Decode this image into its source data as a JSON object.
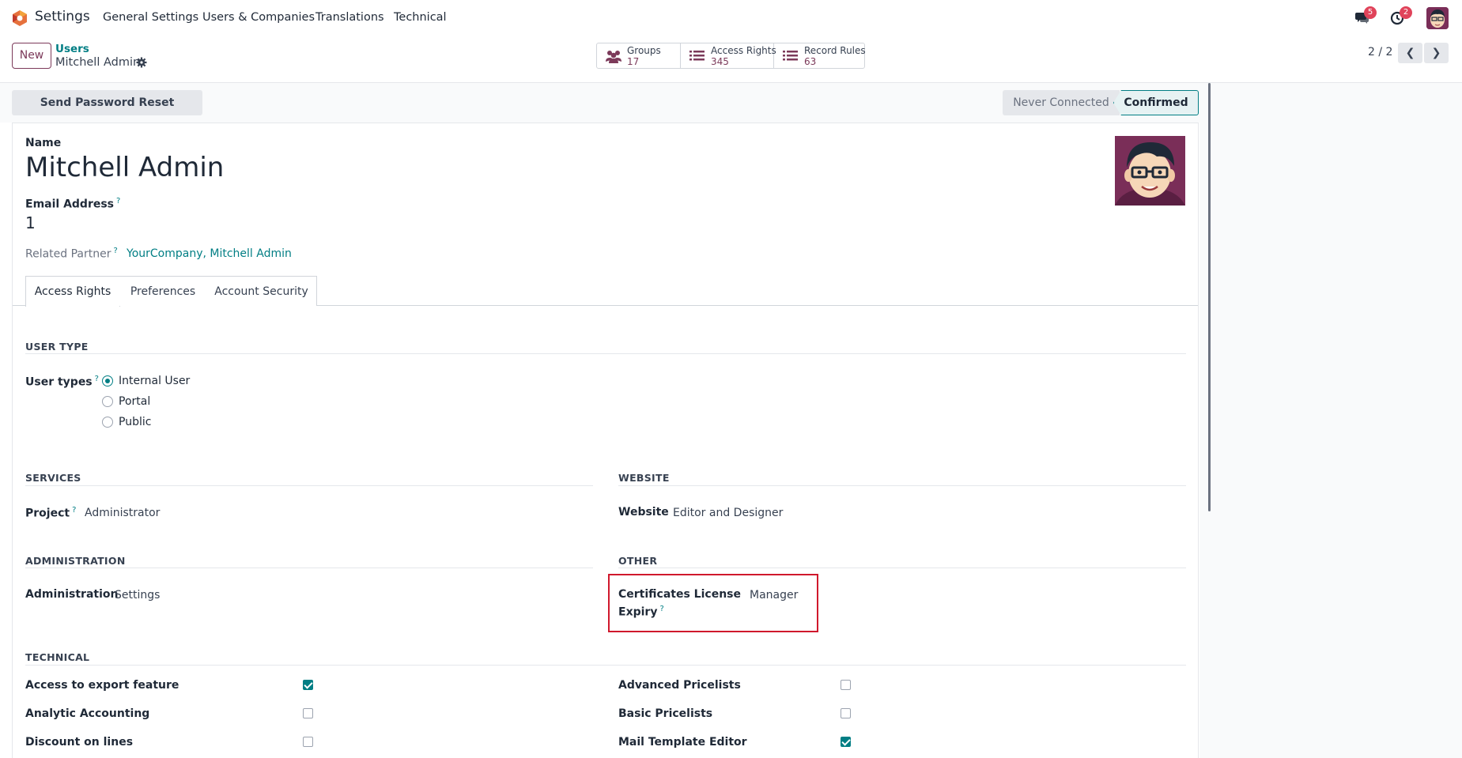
{
  "navbar": {
    "app_name": "Settings",
    "menu": [
      "General Settings",
      "Users & Companies",
      "Translations",
      "Technical"
    ],
    "messages_count": "5",
    "activities_count": "2"
  },
  "control_panel": {
    "new_label": "New",
    "breadcrumb_parent": "Users",
    "breadcrumb_current": "Mitchell Admin",
    "smart_buttons": [
      {
        "label": "Groups",
        "value": "17"
      },
      {
        "label": "Access Rights",
        "value": "345"
      },
      {
        "label": "Record Rules",
        "value": "63"
      }
    ],
    "pager": "2 / 2"
  },
  "statusbar": {
    "reset_button": "Send Password Reset Instructions",
    "stages": [
      "Never Connected",
      "Confirmed"
    ],
    "active_stage": "Confirmed"
  },
  "form": {
    "name_label": "Name",
    "name_value": "Mitchell Admin",
    "email_label": "Email Address",
    "email_value": "1",
    "partner_label": "Related Partner",
    "partner_value": "YourCompany, Mitchell Admin",
    "tabs": [
      "Access Rights",
      "Preferences",
      "Account Security"
    ],
    "active_tab": "Access Rights"
  },
  "access_rights": {
    "user_type_title": "USER TYPE",
    "user_types_label": "User types",
    "user_types": [
      "Internal User",
      "Portal",
      "Public"
    ],
    "user_type_selected": "Internal User",
    "services_title": "SERVICES",
    "project_label": "Project",
    "project_value": "Administrator",
    "website_title": "WEBSITE",
    "website_label": "Website",
    "website_value": "Editor and Designer",
    "administration_title": "ADMINISTRATION",
    "administration_label": "Administration",
    "administration_value": "Settings",
    "other_title": "OTHER",
    "certificates_label_1": "Certificates License",
    "certificates_label_2": "Expiry",
    "certificates_value": "Manager",
    "technical_title": "TECHNICAL",
    "technical_left": [
      {
        "label": "Access to export feature",
        "checked": true
      },
      {
        "label": "Analytic Accounting",
        "checked": false
      },
      {
        "label": "Discount on lines",
        "checked": false
      }
    ],
    "technical_right": [
      {
        "label": "Advanced Pricelists",
        "checked": false
      },
      {
        "label": "Basic Pricelists",
        "checked": false
      },
      {
        "label": "Mail Template Editor",
        "checked": true
      }
    ]
  },
  "colors": {
    "primary": "#7c3a5a",
    "accent": "#017e84",
    "highlight": "#d0182c"
  }
}
